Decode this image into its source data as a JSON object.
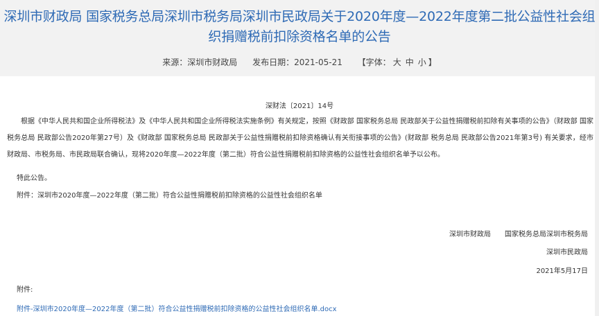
{
  "header": {
    "title": "深圳市财政局 国家税务总局深圳市税务局深圳市民政局关于2020年度—2022年度第二批公益性社会组织捐赠税前扣除资格名单的公告",
    "source": "来源：深圳市财政局",
    "publish_date": "发布日期：2021-05-21",
    "font_size_prefix": "【字体：",
    "font_large": "大",
    "font_medium": "中",
    "font_small": "小",
    "font_size_suffix": "】"
  },
  "body": {
    "doc_number": "深财法〔2021〕14号",
    "paragraph": "根据《中华人民共和国企业所得税法》及《中华人民共和国企业所得税法实施条例》有关规定，按照《财政部 国家税务总局 民政部关于公益性捐赠税前扣除有关事项的公告》（财政部 国家税务总局 民政部公告2020年第27号）及《财政部 国家税务总局 民政部关于公益性捐赠税前扣除资格确认有关衔接事项的公告》(财政部 税务总局 民政部公告2021年第3号) 有关要求，经市财政局、市税务局、市民政局联合确认，现将2020年度—2022年度（第二批）符合公益性捐赠税前扣除资格的公益性社会组织名单予以公布。",
    "special_notice": "特此公告。",
    "attachment_line": "附件：深圳市2020年度—2022年度（第二批）符合公益性捐赠税前扣除资格的公益性社会组织名单",
    "signatory_1": "深圳市财政局",
    "signatory_2": "国家税务总局深圳市税务局",
    "signatory_3": "深圳市民政局",
    "sign_date": "2021年5月17日",
    "attachments_label": "附件:",
    "attachment_link": "附件-深圳市2020年度—2022年度（第二批）符合公益性捐赠税前扣除资格的公益性社会组织名单.docx"
  },
  "colors": {
    "title": "#2e6ab5",
    "header_bg": "#f2f2f2",
    "link": "#2e6ab5"
  }
}
